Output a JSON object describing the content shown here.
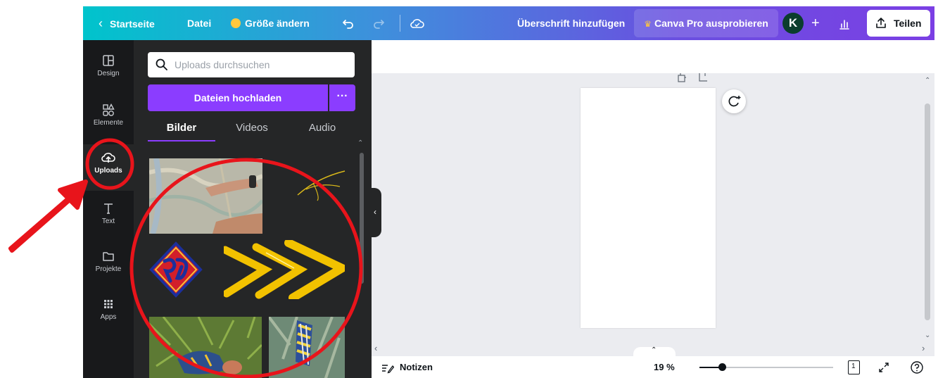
{
  "topbar": {
    "home_label": "Startseite",
    "file_label": "Datei",
    "resize_label": "Größe ändern",
    "add_heading_label": "Überschrift hinzufügen",
    "pro_label": "Canva Pro ausprobieren",
    "avatar_letter": "K",
    "share_label": "Teilen"
  },
  "rail": {
    "items": [
      {
        "label": "Design",
        "icon": "layout-icon"
      },
      {
        "label": "Elemente",
        "icon": "shapes-icon"
      },
      {
        "label": "Uploads",
        "icon": "cloud-upload-icon"
      },
      {
        "label": "Text",
        "icon": "text-icon"
      },
      {
        "label": "Projekte",
        "icon": "folder-icon"
      },
      {
        "label": "Apps",
        "icon": "apps-grid-icon"
      }
    ],
    "active": "Uploads"
  },
  "panel": {
    "search_placeholder": "Uploads durchsuchen",
    "upload_button": "Dateien hochladen",
    "more_button": "···",
    "tabs": [
      "Bilder",
      "Videos",
      "Audio"
    ],
    "active_tab": "Bilder"
  },
  "bottom": {
    "notes_label": "Notizen",
    "zoom_label": "19 %",
    "zoom_percent": 19,
    "page_count": "1"
  },
  "colors": {
    "accent": "#8b3dff",
    "annotation": "#e8141b",
    "topbar_start": "#00c4cc",
    "topbar_end": "#7b3fe4"
  }
}
